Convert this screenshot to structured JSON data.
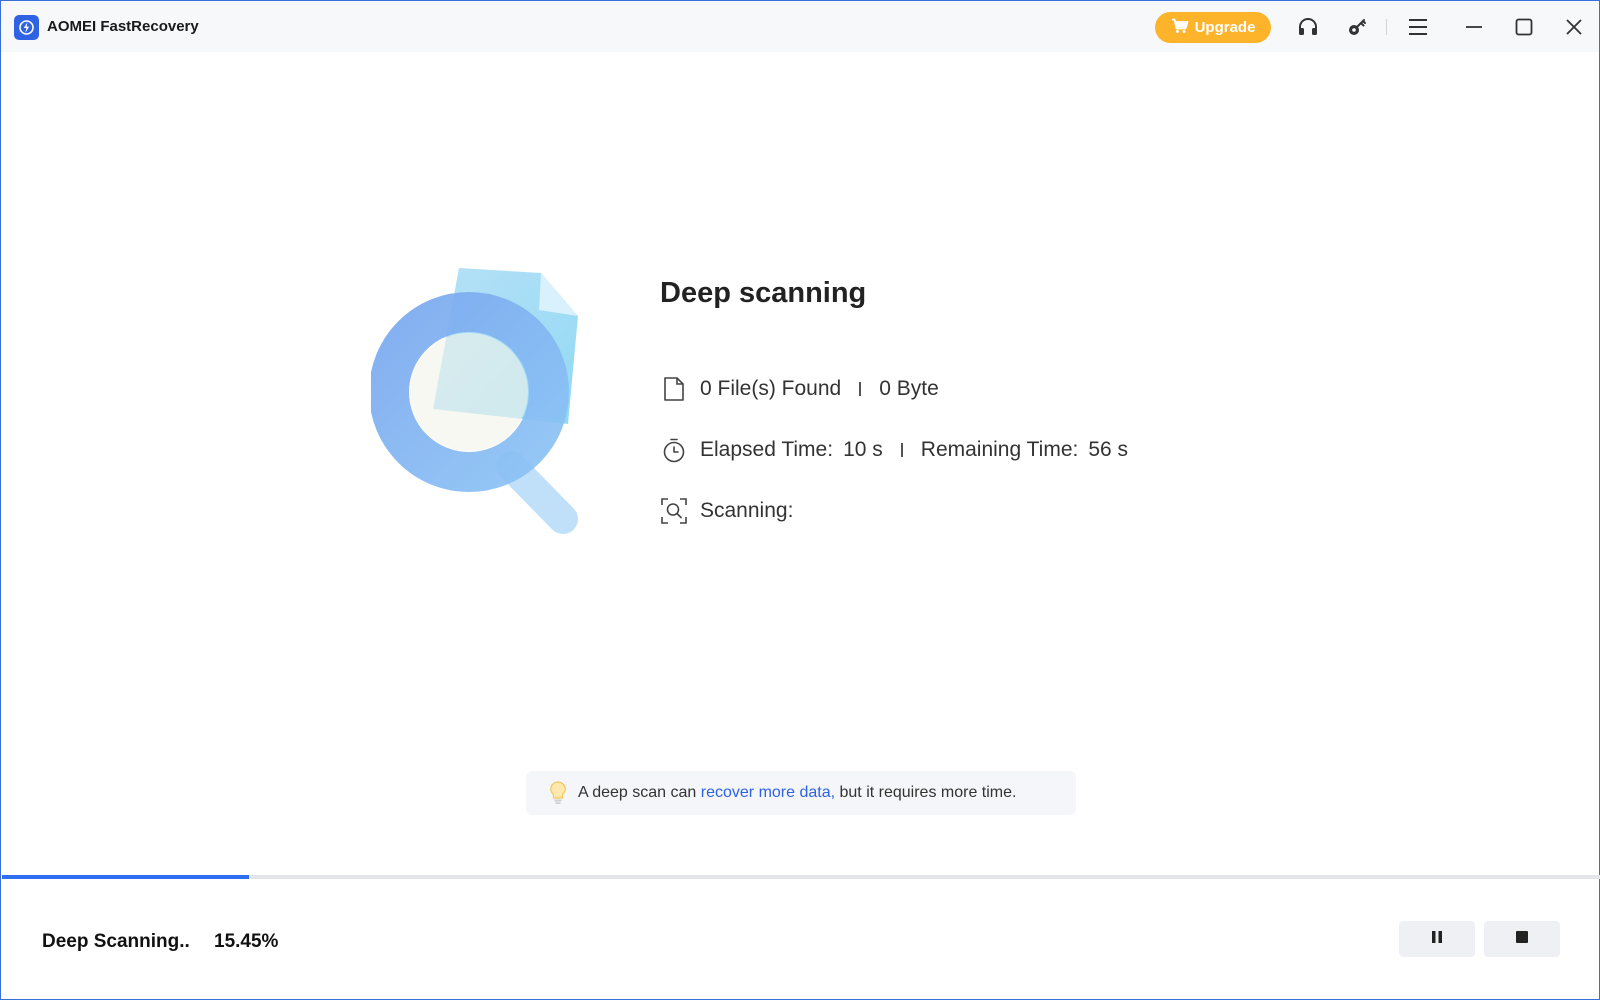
{
  "titlebar": {
    "app_title": "AOMEI FastRecovery",
    "upgrade_label": "Upgrade",
    "accent_color": "#fdb32a",
    "icons": [
      "headset-icon",
      "key-icon",
      "menu-icon",
      "minimize-icon",
      "maximize-icon",
      "close-icon"
    ]
  },
  "scan": {
    "title": "Deep scanning",
    "files_found": "0 File(s) Found",
    "size": "0 Byte",
    "elapsed_label": "Elapsed Time:",
    "elapsed_value": "10 s",
    "remaining_label": "Remaining Time:",
    "remaining_value": "56 s",
    "scanning_label": "Scanning:"
  },
  "tip": {
    "prefix": "A deep scan can",
    "link": "recover more data,",
    "suffix": "but it requires more time."
  },
  "status": {
    "label": "Deep Scanning..",
    "percent_text": "15.45%",
    "progress": 0.1545,
    "progress_color": "#2f6ef0"
  },
  "controls": {
    "pause_icon": "pause-icon",
    "stop_icon": "stop-icon"
  }
}
